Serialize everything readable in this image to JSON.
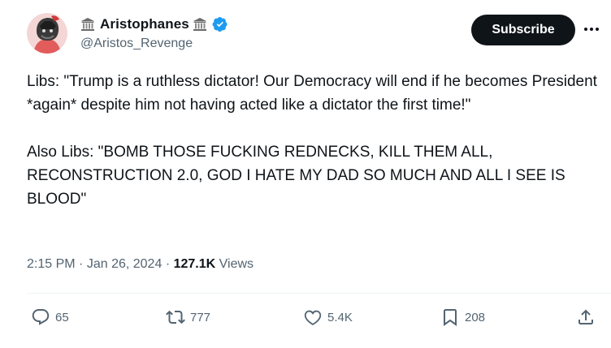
{
  "author": {
    "display_name": "Aristophanes",
    "handle": "@Aristos_Revenge",
    "verified": true,
    "name_emoji_icon": "classical-building-icon"
  },
  "subscribe_label": "Subscribe",
  "more_icon": "more-horizontal-icon",
  "tweet": {
    "paragraph_1": "Libs: \"Trump is a ruthless dictator! Our Democracy will end if he becomes President *again* despite him not having acted like a dictator the first time!\"",
    "paragraph_2": "Also Libs: \"BOMB THOSE FUCKING REDNECKS, KILL THEM ALL, RECONSTRUCTION 2.0, GOD I HATE MY DAD SO MUCH AND ALL I SEE IS BLOOD\""
  },
  "meta": {
    "time": "2:15 PM",
    "date": "Jan 26, 2024",
    "separator": "·",
    "views_count": "127.1K",
    "views_label": "Views"
  },
  "actions": {
    "replies": "65",
    "reposts": "777",
    "likes": "5.4K",
    "bookmarks": "208"
  },
  "colors": {
    "text": "#0f1419",
    "secondary": "#536471",
    "verified": "#1d9bf0",
    "divider": "#eff3f4",
    "button_bg": "#0f1419"
  }
}
